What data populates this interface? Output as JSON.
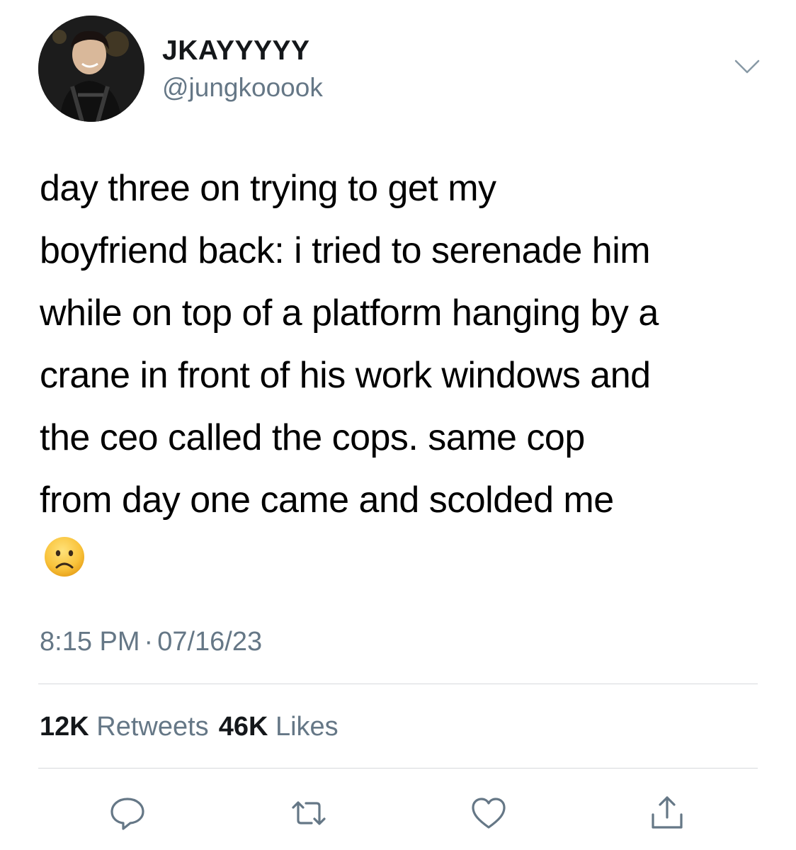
{
  "author": {
    "display_name": "JKAYYYYY",
    "handle": "@jungkooook",
    "avatar_icon": "profile-photo"
  },
  "tweet": {
    "lines": [
      "day three on trying to get my",
      "boyfriend back: i tried to serenade him",
      "while on top of a platform hanging by a",
      "crane in front of his work windows and",
      "the ceo called the cops. same cop",
      "from day one came and scolded me"
    ],
    "emoji": "frowning-face"
  },
  "meta": {
    "time": "8:15 PM",
    "separator": "·",
    "date": "07/16/23"
  },
  "stats": {
    "retweets_count": "12K",
    "retweets_label": "Retweets",
    "likes_count": "46K",
    "likes_label": "Likes"
  },
  "actions": [
    "reply-icon",
    "retweet-icon",
    "like-icon",
    "share-icon"
  ],
  "colors": {
    "secondary_text": "#657786",
    "primary_text": "#14171a",
    "divider": "#d6d9dc",
    "icon": "#657786"
  }
}
